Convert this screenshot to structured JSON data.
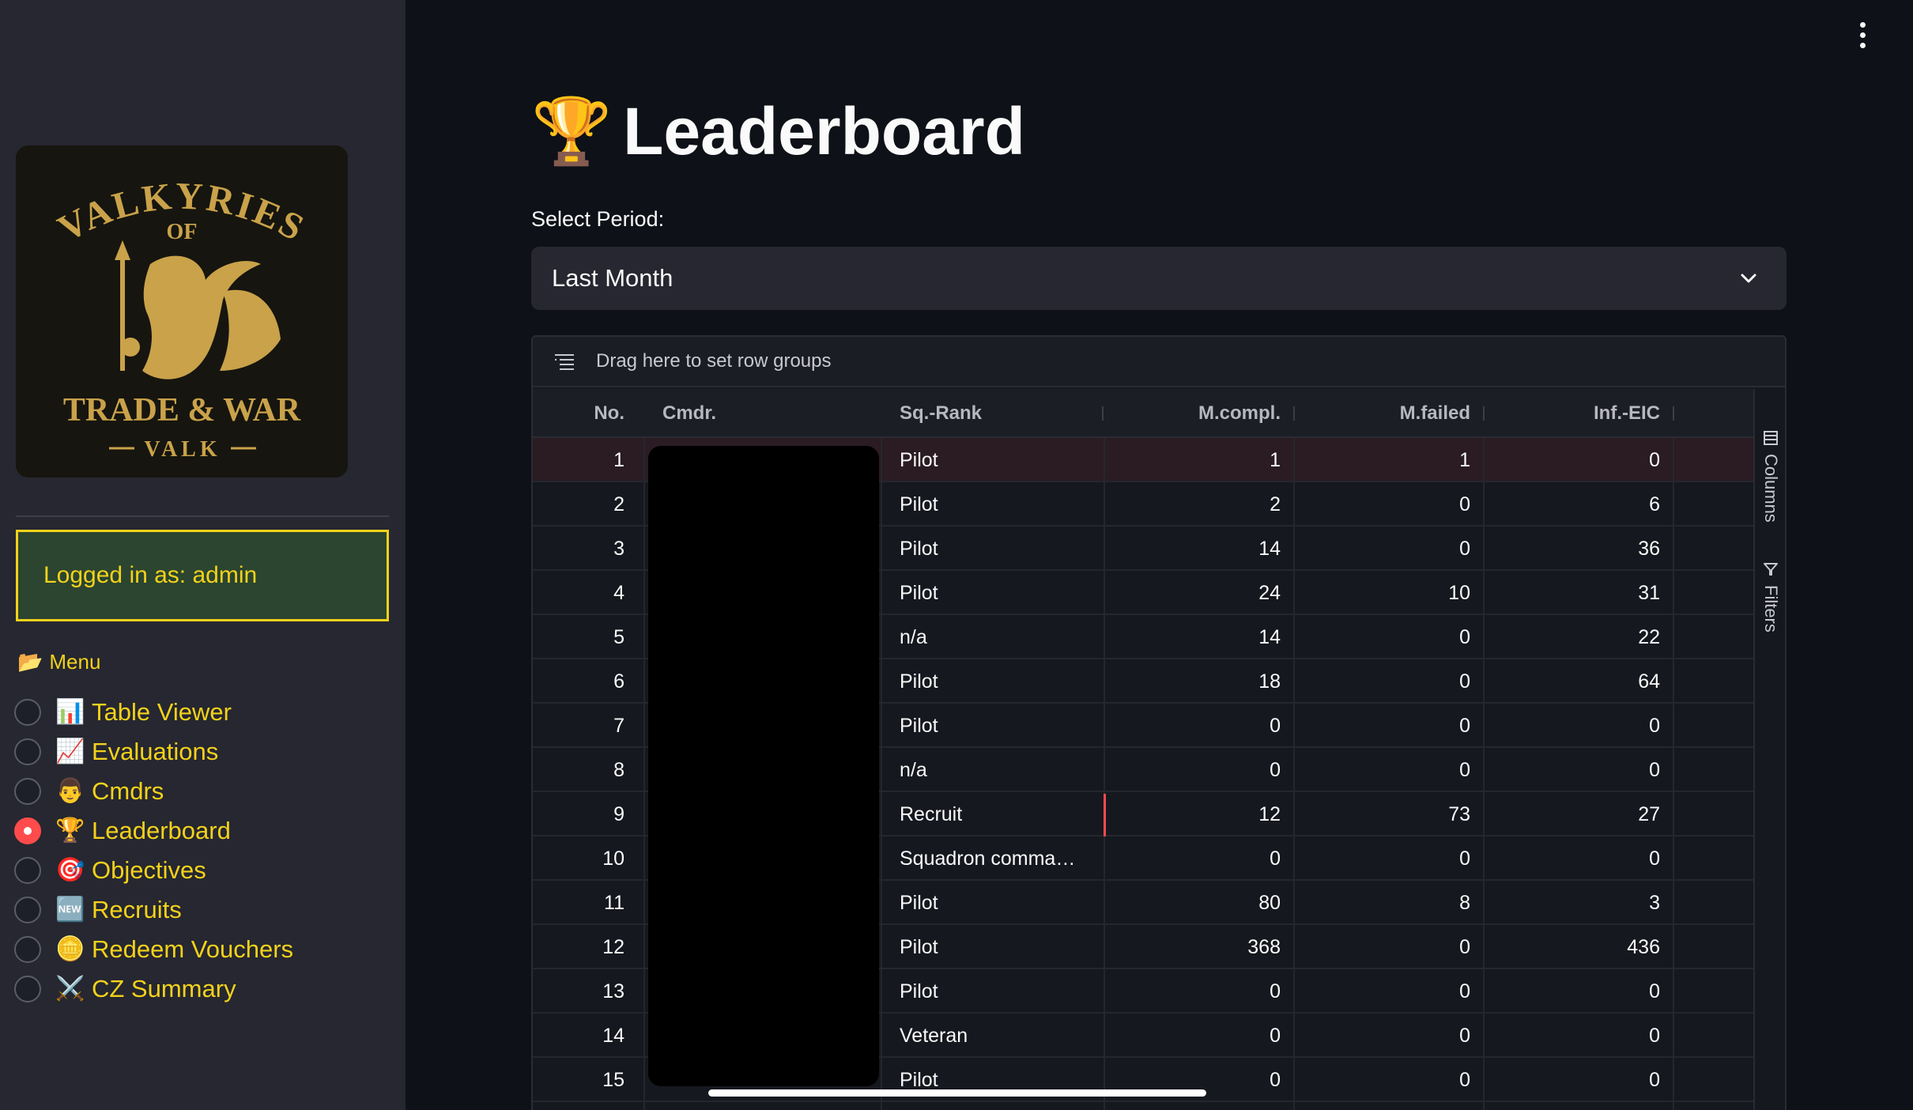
{
  "sidebar": {
    "logo": {
      "line1": "VALKYRIES",
      "line2": "OF",
      "line3": "TRADE & WAR",
      "line4": "VALK"
    },
    "login_text": "Logged in as: admin",
    "menu_title": "Menu",
    "menu_icon": "📂",
    "items": [
      {
        "icon": "📊",
        "label": "Table Viewer",
        "selected": false
      },
      {
        "icon": "📈",
        "label": "Evaluations",
        "selected": false
      },
      {
        "icon": "👨",
        "label": "Cmdrs",
        "selected": false
      },
      {
        "icon": "🏆",
        "label": "Leaderboard",
        "selected": true
      },
      {
        "icon": "🎯",
        "label": "Objectives",
        "selected": false
      },
      {
        "icon": "🆕",
        "label": "Recruits",
        "selected": false
      },
      {
        "icon": "🪙",
        "label": "Redeem Vouchers",
        "selected": false
      },
      {
        "icon": "⚔️",
        "label": "CZ Summary",
        "selected": false
      }
    ]
  },
  "main": {
    "title_icon": "🏆",
    "title": "Leaderboard",
    "period_label": "Select Period:",
    "period_value": "Last Month"
  },
  "grid": {
    "group_hint": "Drag here to set row groups",
    "columns": [
      "No.",
      "Cmdr.",
      "Sq.-Rank",
      "M.compl.",
      "M.failed",
      "Inf.-EIC"
    ],
    "side_buttons": {
      "columns": "Columns",
      "filters": "Filters"
    },
    "rows": [
      {
        "no": "1",
        "rank": "Pilot",
        "compl": "1",
        "failed": "1",
        "inf": "0"
      },
      {
        "no": "2",
        "rank": "Pilot",
        "compl": "2",
        "failed": "0",
        "inf": "6"
      },
      {
        "no": "3",
        "rank": "Pilot",
        "compl": "14",
        "failed": "0",
        "inf": "36"
      },
      {
        "no": "4",
        "rank": "Pilot",
        "compl": "24",
        "failed": "10",
        "inf": "31"
      },
      {
        "no": "5",
        "rank": "n/a",
        "compl": "14",
        "failed": "0",
        "inf": "22"
      },
      {
        "no": "6",
        "rank": "Pilot",
        "compl": "18",
        "failed": "0",
        "inf": "64"
      },
      {
        "no": "7",
        "rank": "Pilot",
        "compl": "0",
        "failed": "0",
        "inf": "0"
      },
      {
        "no": "8",
        "rank": "n/a",
        "compl": "0",
        "failed": "0",
        "inf": "0"
      },
      {
        "no": "9",
        "rank": "Recruit",
        "compl": "12",
        "failed": "73",
        "inf": "27"
      },
      {
        "no": "10",
        "rank": "Squadron comma…",
        "compl": "0",
        "failed": "0",
        "inf": "0"
      },
      {
        "no": "11",
        "rank": "Pilot",
        "compl": "80",
        "failed": "8",
        "inf": "3"
      },
      {
        "no": "12",
        "rank": "Pilot",
        "compl": "368",
        "failed": "0",
        "inf": "436"
      },
      {
        "no": "13",
        "rank": "Pilot",
        "compl": "0",
        "failed": "0",
        "inf": "0"
      },
      {
        "no": "14",
        "rank": "Veteran",
        "compl": "0",
        "failed": "0",
        "inf": "0"
      },
      {
        "no": "15",
        "rank": "Pilot",
        "compl": "0",
        "failed": "0",
        "inf": "0"
      }
    ]
  },
  "colors": {
    "accent": "#f3d21b",
    "selected_radio": "#ff4b4b",
    "background": "#0e1117",
    "sidebar": "#262730"
  }
}
